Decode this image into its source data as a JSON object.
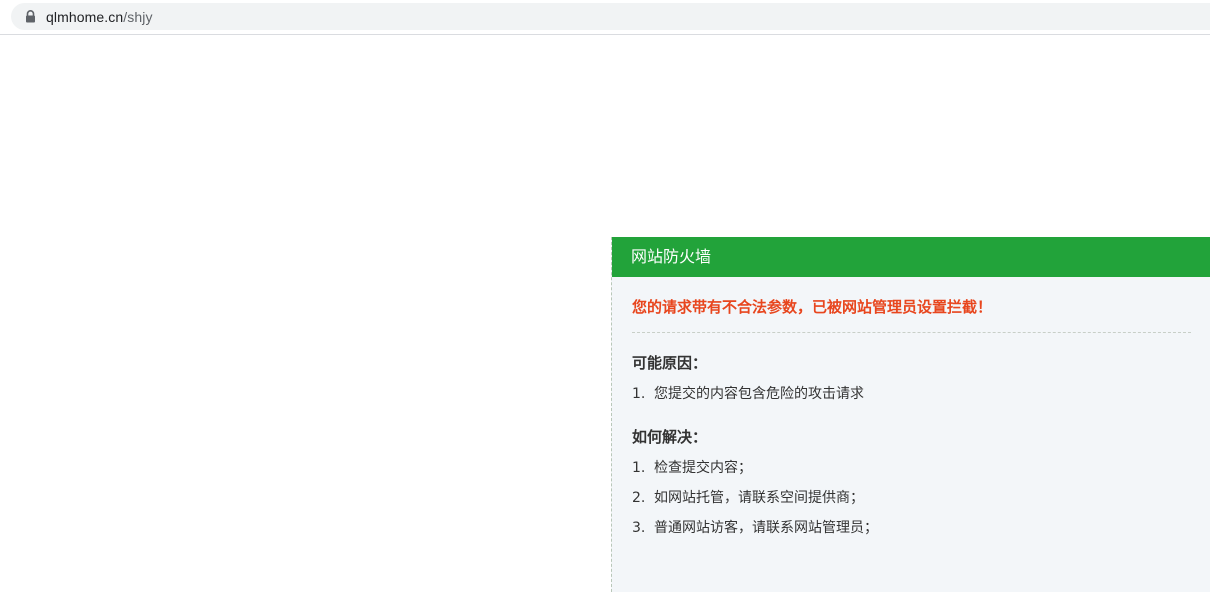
{
  "browser": {
    "url_host": "qlmhome.cn",
    "url_path": "/shjy"
  },
  "panel": {
    "title": "网站防火墙",
    "warning": "您的请求带有不合法参数，已被网站管理员设置拦截！",
    "reasons": {
      "heading": "可能原因：",
      "items": [
        {
          "num": "1.",
          "text": "您提交的内容包含危险的攻击请求"
        }
      ]
    },
    "solutions": {
      "heading": "如何解决：",
      "items": [
        {
          "num": "1.",
          "text": "检查提交内容；"
        },
        {
          "num": "2.",
          "text": "如网站托管，请联系空间提供商；"
        },
        {
          "num": "3.",
          "text": "普通网站访客，请联系网站管理员；"
        }
      ]
    }
  },
  "colors": {
    "header_green": "#22a33a",
    "warning_red": "#e8461e",
    "panel_bg": "#f3f6f9"
  }
}
